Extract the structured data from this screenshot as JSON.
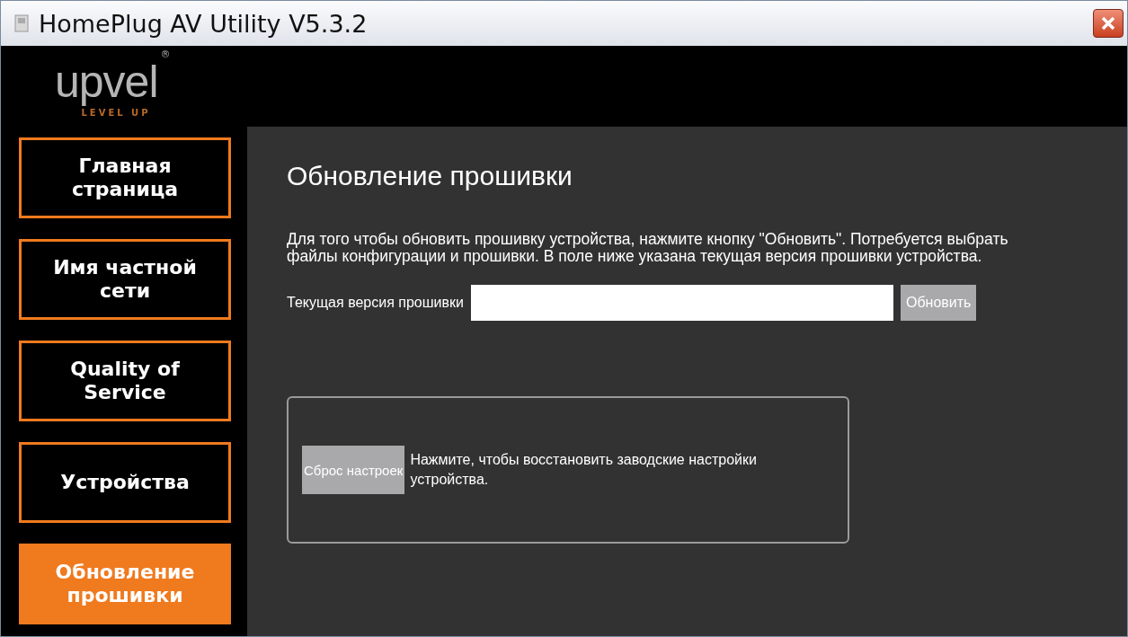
{
  "window": {
    "title": "HomePlug AV Utility V5.3.2"
  },
  "logo": {
    "text": "upvel",
    "mark": "®",
    "tagline": "LEVEL UP"
  },
  "sidebar": {
    "items": [
      {
        "label": "Главная страница",
        "selected": false
      },
      {
        "label": "Имя частной сети",
        "selected": false
      },
      {
        "label": "Quality of Service",
        "selected": false
      },
      {
        "label": "Устройства",
        "selected": false
      },
      {
        "label": "Обновление прошивки",
        "selected": true
      }
    ]
  },
  "content": {
    "heading": "Обновление прошивки",
    "description": "Для того чтобы обновить прошивку устройства, нажмите кнопку \"Обновить\". Потребуется выбрать файлы конфигурации и прошивки. В поле ниже указана текущая версия прошивки устройства.",
    "version_label": "Текущая версия прошивки",
    "update_button": "Обновить",
    "reset": {
      "button": "Сброс настроек",
      "text": "Нажмите, чтобы восстановить заводские настройки устройства."
    }
  }
}
